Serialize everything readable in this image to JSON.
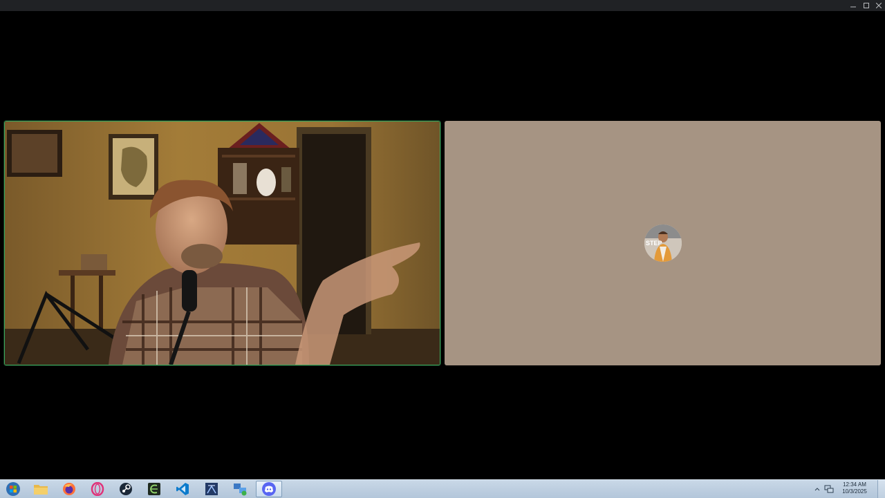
{
  "window": {
    "controls": {
      "minimize_icon": "minimize-icon",
      "maximize_icon": "maximize-icon",
      "close_icon": "close-icon"
    }
  },
  "call": {
    "accent_speaking": "#3ba55c",
    "audio_tile_background": "#a69483",
    "avatar_caption": "STEP"
  },
  "taskbar": {
    "apps": [
      {
        "name": "start-button",
        "icon": "windows-logo-icon"
      },
      {
        "name": "file-explorer",
        "icon": "folder-icon"
      },
      {
        "name": "firefox",
        "icon": "firefox-icon"
      },
      {
        "name": "opera",
        "icon": "opera-icon"
      },
      {
        "name": "steam",
        "icon": "steam-icon"
      },
      {
        "name": "app-green",
        "icon": "green-app-icon"
      },
      {
        "name": "vscode",
        "icon": "vscode-icon"
      },
      {
        "name": "ssms",
        "icon": "ssms-icon"
      },
      {
        "name": "network-app",
        "icon": "network-icon"
      },
      {
        "name": "discord",
        "icon": "discord-icon",
        "active": true
      }
    ],
    "clock": {
      "time": "12:34 AM",
      "date": "10/3/2025"
    }
  }
}
